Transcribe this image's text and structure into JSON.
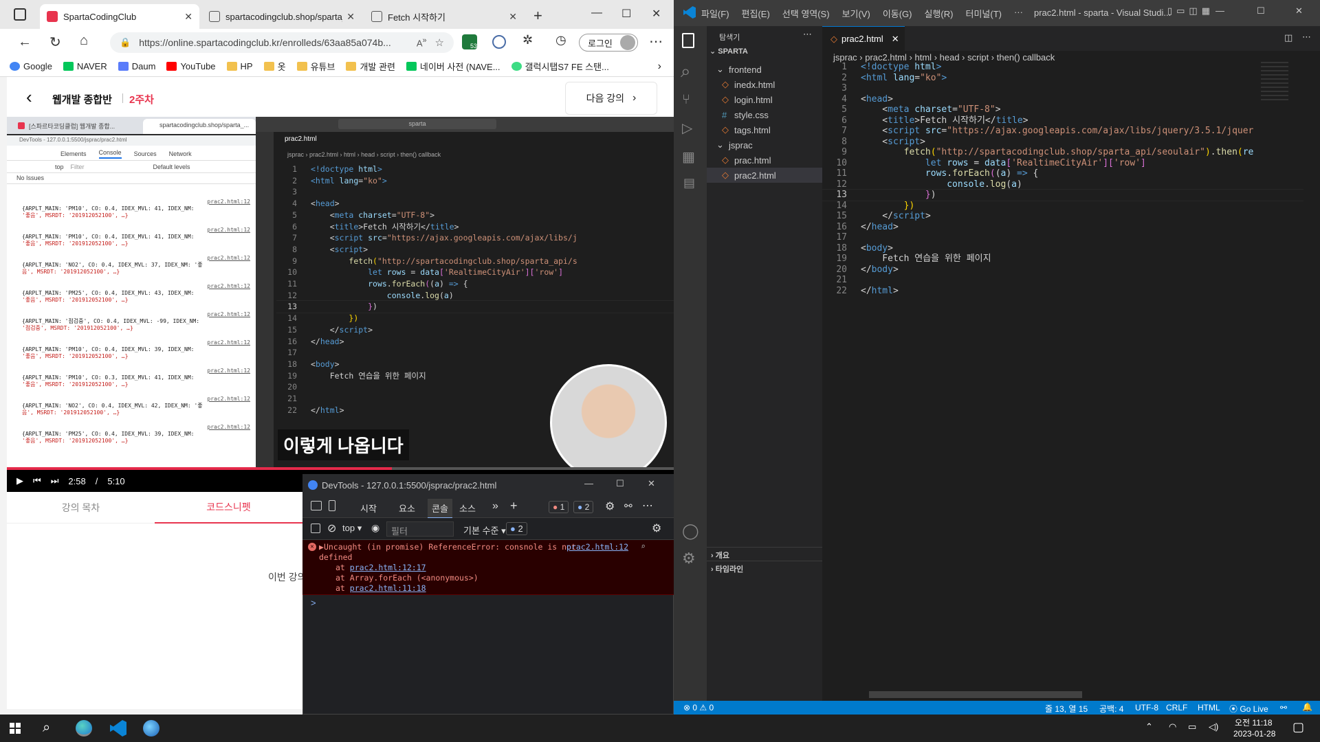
{
  "edge": {
    "tabs": [
      {
        "label": "SpartaCodingClub",
        "icon": "sparta-favicon"
      },
      {
        "label": "spartacodingclub.shop/sparta_a...",
        "icon": "page-icon"
      },
      {
        "label": "Fetch 시작하기",
        "icon": "page-icon"
      }
    ],
    "address": "https://online.spartacodingclub.kr/enrolleds/63aa85a074b...",
    "badge_count": "53",
    "login_label": "로그인",
    "bookmarks": [
      "Google",
      "NAVER",
      "Daum",
      "YouTube",
      "HP",
      "옷",
      "유튜브",
      "개발 관련",
      "네이버 사전 (NAVE...",
      "갤럭시탭S7 FE 스탠..."
    ]
  },
  "course": {
    "title": "웹개발 종합반",
    "week": "2주차",
    "next_label": "다음 강의",
    "tabs": [
      "강의 목차",
      "코드스니펫"
    ],
    "body_partial": "이번 강의"
  },
  "player": {
    "current": "2:58",
    "separator": "/",
    "total": "5:10",
    "progress": 0.577,
    "caption": "이렇게 나옵니다"
  },
  "inner_browser": {
    "tabs": [
      "[스파르타코딩클럽] 웹개발 종합...",
      "spartacodingclub.shop/sparta_..."
    ],
    "devtools_title": "DevTools - 127.0.0.1:5500/jsprac/prac2.html",
    "devtools_tabs": [
      "Elements",
      "Console",
      "Sources",
      "Network"
    ],
    "context": "top",
    "filter_placeholder": "Filter",
    "levels": "Default levels",
    "issues": "No Issues",
    "log_source": "prac2.html:12",
    "logs": [
      {
        "l1": "{ARPLT_MAIN: 'PM10', CO: 0.4, IDEX_MVL: 41, IDEX_NM:",
        "l2": "'좋음', MSRDT: '201912052100', …}"
      },
      {
        "l1": "{ARPLT_MAIN: 'PM10', CO: 0.4, IDEX_MVL: 41, IDEX_NM:",
        "l2": "'좋음', MSRDT: '201912052100', …}"
      },
      {
        "l1": "{ARPLT_MAIN: 'NO2', CO: 0.4, IDEX_MVL: 37, IDEX_NM: '좋",
        "l2": "음', MSRDT: '201912052100', …}"
      },
      {
        "l1": "{ARPLT_MAIN: 'PM25', CO: 0.4, IDEX_MVL: 43, IDEX_NM:",
        "l2": "'좋음', MSRDT: '201912052100', …}"
      },
      {
        "l1": "{ARPLT_MAIN: '점검중', CO: 0.4, IDEX_MVL: -99, IDEX_NM:",
        "l2": "'점검중', MSRDT: '201912052100', …}"
      },
      {
        "l1": "{ARPLT_MAIN: 'PM10', CO: 0.4, IDEX_MVL: 39, IDEX_NM:",
        "l2": "'좋음', MSRDT: '201912052100', …}"
      },
      {
        "l1": "{ARPLT_MAIN: 'PM10', CO: 0.3, IDEX_MVL: 41, IDEX_NM:",
        "l2": "'좋음', MSRDT: '201912052100', …}"
      },
      {
        "l1": "{ARPLT_MAIN: 'NO2', CO: 0.4, IDEX_MVL: 42, IDEX_NM: '좋",
        "l2": "음', MSRDT: '201912052100', …}"
      },
      {
        "l1": "{ARPLT_MAIN: 'PM25', CO: 0.4, IDEX_MVL: 39, IDEX_NM:",
        "l2": "'좋음', MSRDT: '201912052100', …}"
      }
    ]
  },
  "inner_vscode": {
    "search": "sparta",
    "tab": "prac2.html",
    "crumbs": [
      "jsprac",
      "prac2.html",
      "html",
      "head",
      "script",
      "then() callback"
    ]
  },
  "devtools": {
    "title": "DevTools - 127.0.0.1:5500/jsprac/prac2.html",
    "tabs": [
      "시작",
      "요소",
      "콘솔",
      "소스"
    ],
    "errors": "1",
    "warnings": "2",
    "context": "top",
    "filter_placeholder": "필터",
    "level": "기본 수준",
    "issue_count": "2",
    "error_main": "Uncaught (in promise) ReferenceError: consnole is not",
    "error_main2": "defined",
    "error_src": "prac2.html:12",
    "stack": [
      {
        "pre": "at ",
        "link": "prac2.html:12:17",
        "post": ""
      },
      {
        "pre": "at Array.forEach (<anonymous>)",
        "link": "",
        "post": ""
      },
      {
        "pre": "at ",
        "link": "prac2.html:11:18",
        "post": ""
      }
    ],
    "prompt": ">"
  },
  "vscode": {
    "menu": [
      "파일(F)",
      "편집(E)",
      "선택 영역(S)",
      "보기(V)",
      "이동(G)",
      "실행(R)",
      "터미널(T)",
      "···"
    ],
    "title": "prac2.html - sparta - Visual Studi...",
    "explorer_title": "탐색기",
    "root": "SPARTA",
    "tree": [
      {
        "label": "frontend",
        "type": "folder",
        "level": 1
      },
      {
        "label": "inedx.html",
        "type": "html",
        "level": 2
      },
      {
        "label": "login.html",
        "type": "html",
        "level": 2
      },
      {
        "label": "style.css",
        "type": "css",
        "level": 2
      },
      {
        "label": "tags.html",
        "type": "html",
        "level": 2
      },
      {
        "label": "jsprac",
        "type": "folder",
        "level": 1
      },
      {
        "label": "prac.html",
        "type": "html",
        "level": 2
      },
      {
        "label": "prac2.html",
        "type": "html",
        "level": 2,
        "selected": true
      }
    ],
    "outline": "개요",
    "timeline": "타임라인",
    "tab": "prac2.html",
    "crumbs": [
      "jsprac",
      "prac2.html",
      "html",
      "head",
      "script",
      "then() callback"
    ],
    "current_line": 13,
    "status": {
      "errors": "0",
      "warnings": "0",
      "position": "줄 13, 열 15",
      "spaces": "공백: 4",
      "encoding": "UTF-8",
      "eol": "CRLF",
      "lang": "HTML",
      "live": "Go Live"
    }
  },
  "code_lines": [
    [
      [
        "k",
        "<!doctype "
      ],
      [
        "a",
        "html"
      ],
      [
        "k",
        ">"
      ]
    ],
    [
      [
        "k",
        "<html "
      ],
      [
        "a",
        "lang"
      ],
      [
        "p",
        "="
      ],
      [
        "s2",
        "\"ko\""
      ],
      [
        "k",
        ">"
      ]
    ],
    [],
    [
      [
        "p",
        "<"
      ],
      [
        "t",
        "head"
      ],
      [
        "p",
        ">"
      ]
    ],
    [
      [
        "p",
        "    <"
      ],
      [
        "t",
        "meta "
      ],
      [
        "a",
        "charset"
      ],
      [
        "p",
        "="
      ],
      [
        "s2",
        "\"UTF-8\""
      ],
      [
        "p",
        ">"
      ]
    ],
    [
      [
        "p",
        "    <"
      ],
      [
        "t",
        "title"
      ],
      [
        "p",
        ">Fetch 시작하기</"
      ],
      [
        "t",
        "title"
      ],
      [
        "p",
        ">"
      ]
    ],
    [
      [
        "p",
        "    <"
      ],
      [
        "t",
        "script "
      ],
      [
        "a",
        "src"
      ],
      [
        "p",
        "="
      ],
      [
        "s2",
        "\"https://ajax.googleapis.com/ajax/libs/jquery/3.5.1/jquer"
      ]
    ],
    [
      [
        "p",
        "    <"
      ],
      [
        "t",
        "script"
      ],
      [
        "p",
        ">"
      ]
    ],
    [
      [
        "p",
        "        "
      ],
      [
        "f",
        "fetch"
      ],
      [
        "br",
        "("
      ],
      [
        "s2",
        "\"http://spartacodingclub.shop/sparta_api/seoulair\""
      ],
      [
        "br",
        ")"
      ],
      [
        "p",
        "."
      ],
      [
        "f",
        "then"
      ],
      [
        "br",
        "("
      ],
      [
        "a",
        "re"
      ]
    ],
    [
      [
        "p",
        "            "
      ],
      [
        "k",
        "let "
      ],
      [
        "a",
        "rows "
      ],
      [
        "p",
        "= "
      ],
      [
        "a",
        "data"
      ],
      [
        "br2",
        "["
      ],
      [
        "s2",
        "'RealtimeCityAir'"
      ],
      [
        "br2",
        "]["
      ],
      [
        "s2",
        "'row'"
      ],
      [
        "br2",
        "]"
      ]
    ],
    [
      [
        "p",
        "            "
      ],
      [
        "a",
        "rows"
      ],
      [
        "p",
        "."
      ],
      [
        "f",
        "forEach"
      ],
      [
        "br2",
        "("
      ],
      [
        "p",
        "("
      ],
      [
        "a",
        "a"
      ],
      [
        "p",
        ") "
      ],
      [
        "k",
        "=>"
      ],
      [
        "p",
        " {"
      ]
    ],
    [
      [
        "p",
        "                "
      ],
      [
        "a",
        "console"
      ],
      [
        "p",
        "."
      ],
      [
        "f",
        "log"
      ],
      [
        "p",
        "("
      ],
      [
        "a",
        "a"
      ],
      [
        "p",
        ")"
      ]
    ],
    [
      [
        "p",
        "            "
      ],
      [
        "br2",
        "}"
      ],
      [
        "p",
        ")"
      ]
    ],
    [
      [
        "p",
        "        "
      ],
      [
        "br",
        "})"
      ]
    ],
    [
      [
        "p",
        "    </"
      ],
      [
        "t",
        "script"
      ],
      [
        "p",
        ">"
      ]
    ],
    [
      [
        "p",
        "</"
      ],
      [
        "t",
        "head"
      ],
      [
        "p",
        ">"
      ]
    ],
    [],
    [
      [
        "p",
        "<"
      ],
      [
        "t",
        "body"
      ],
      [
        "p",
        ">"
      ]
    ],
    [
      [
        "p",
        "    Fetch 연습을 위한 페이지"
      ]
    ],
    [
      [
        "p",
        "</"
      ],
      [
        "t",
        "body"
      ],
      [
        "p",
        ">"
      ]
    ],
    [],
    [
      [
        "p",
        "</"
      ],
      [
        "t",
        "html"
      ],
      [
        "p",
        ">"
      ]
    ]
  ],
  "code_lines_inner": [
    [
      [
        "k",
        "<!doctype "
      ],
      [
        "a",
        "html"
      ],
      [
        "k",
        ">"
      ]
    ],
    [
      [
        "k",
        "<html "
      ],
      [
        "a",
        "lang"
      ],
      [
        "p",
        "="
      ],
      [
        "s2",
        "\"ko\""
      ],
      [
        "k",
        ">"
      ]
    ],
    [],
    [
      [
        "p",
        "<"
      ],
      [
        "t",
        "head"
      ],
      [
        "p",
        ">"
      ]
    ],
    [
      [
        "p",
        "    <"
      ],
      [
        "t",
        "meta "
      ],
      [
        "a",
        "charset"
      ],
      [
        "p",
        "="
      ],
      [
        "s2",
        "\"UTF-8\""
      ],
      [
        "p",
        ">"
      ]
    ],
    [
      [
        "p",
        "    <"
      ],
      [
        "t",
        "title"
      ],
      [
        "p",
        ">Fetch 시작하기</"
      ],
      [
        "t",
        "title"
      ],
      [
        "p",
        ">"
      ]
    ],
    [
      [
        "p",
        "    <"
      ],
      [
        "t",
        "script "
      ],
      [
        "a",
        "src"
      ],
      [
        "p",
        "="
      ],
      [
        "s2",
        "\"https://ajax.googleapis.com/ajax/libs/j"
      ]
    ],
    [
      [
        "p",
        "    <"
      ],
      [
        "t",
        "script"
      ],
      [
        "p",
        ">"
      ]
    ],
    [
      [
        "p",
        "        "
      ],
      [
        "f",
        "fetch"
      ],
      [
        "br",
        "("
      ],
      [
        "s2",
        "\"http://spartacodingclub.shop/sparta_api/s"
      ]
    ],
    [
      [
        "p",
        "            "
      ],
      [
        "k",
        "let "
      ],
      [
        "a",
        "rows "
      ],
      [
        "p",
        "= "
      ],
      [
        "a",
        "data"
      ],
      [
        "br2",
        "["
      ],
      [
        "s2",
        "'RealtimeCityAir'"
      ],
      [
        "br2",
        "]["
      ],
      [
        "s2",
        "'row'"
      ],
      [
        "br2",
        "]"
      ]
    ],
    [
      [
        "p",
        "            "
      ],
      [
        "a",
        "rows"
      ],
      [
        "p",
        "."
      ],
      [
        "f",
        "forEach"
      ],
      [
        "br2",
        "("
      ],
      [
        "p",
        "("
      ],
      [
        "a",
        "a"
      ],
      [
        "p",
        ") "
      ],
      [
        "k",
        "=>"
      ],
      [
        "p",
        " {"
      ]
    ],
    [
      [
        "p",
        "                "
      ],
      [
        "a",
        "console"
      ],
      [
        "p",
        "."
      ],
      [
        "f",
        "log"
      ],
      [
        "p",
        "("
      ],
      [
        "a",
        "a"
      ],
      [
        "p",
        ")"
      ]
    ],
    [
      [
        "p",
        "            "
      ],
      [
        "br2",
        "}"
      ],
      [
        "p",
        ")"
      ]
    ],
    [
      [
        "p",
        "        "
      ],
      [
        "br",
        "})"
      ]
    ],
    [
      [
        "p",
        "    </"
      ],
      [
        "t",
        "script"
      ],
      [
        "p",
        ">"
      ]
    ],
    [
      [
        "p",
        "</"
      ],
      [
        "t",
        "head"
      ],
      [
        "p",
        ">"
      ]
    ],
    [],
    [
      [
        "p",
        "<"
      ],
      [
        "t",
        "body"
      ],
      [
        "p",
        ">"
      ]
    ],
    [
      [
        "p",
        "    Fetch 연습을 위한 페이지"
      ]
    ],
    [],
    [],
    [
      [
        "p",
        "</"
      ],
      [
        "t",
        "html"
      ],
      [
        "p",
        ">"
      ]
    ]
  ],
  "taskbar": {
    "time": "오전 11:18",
    "date": "2023-01-28"
  }
}
